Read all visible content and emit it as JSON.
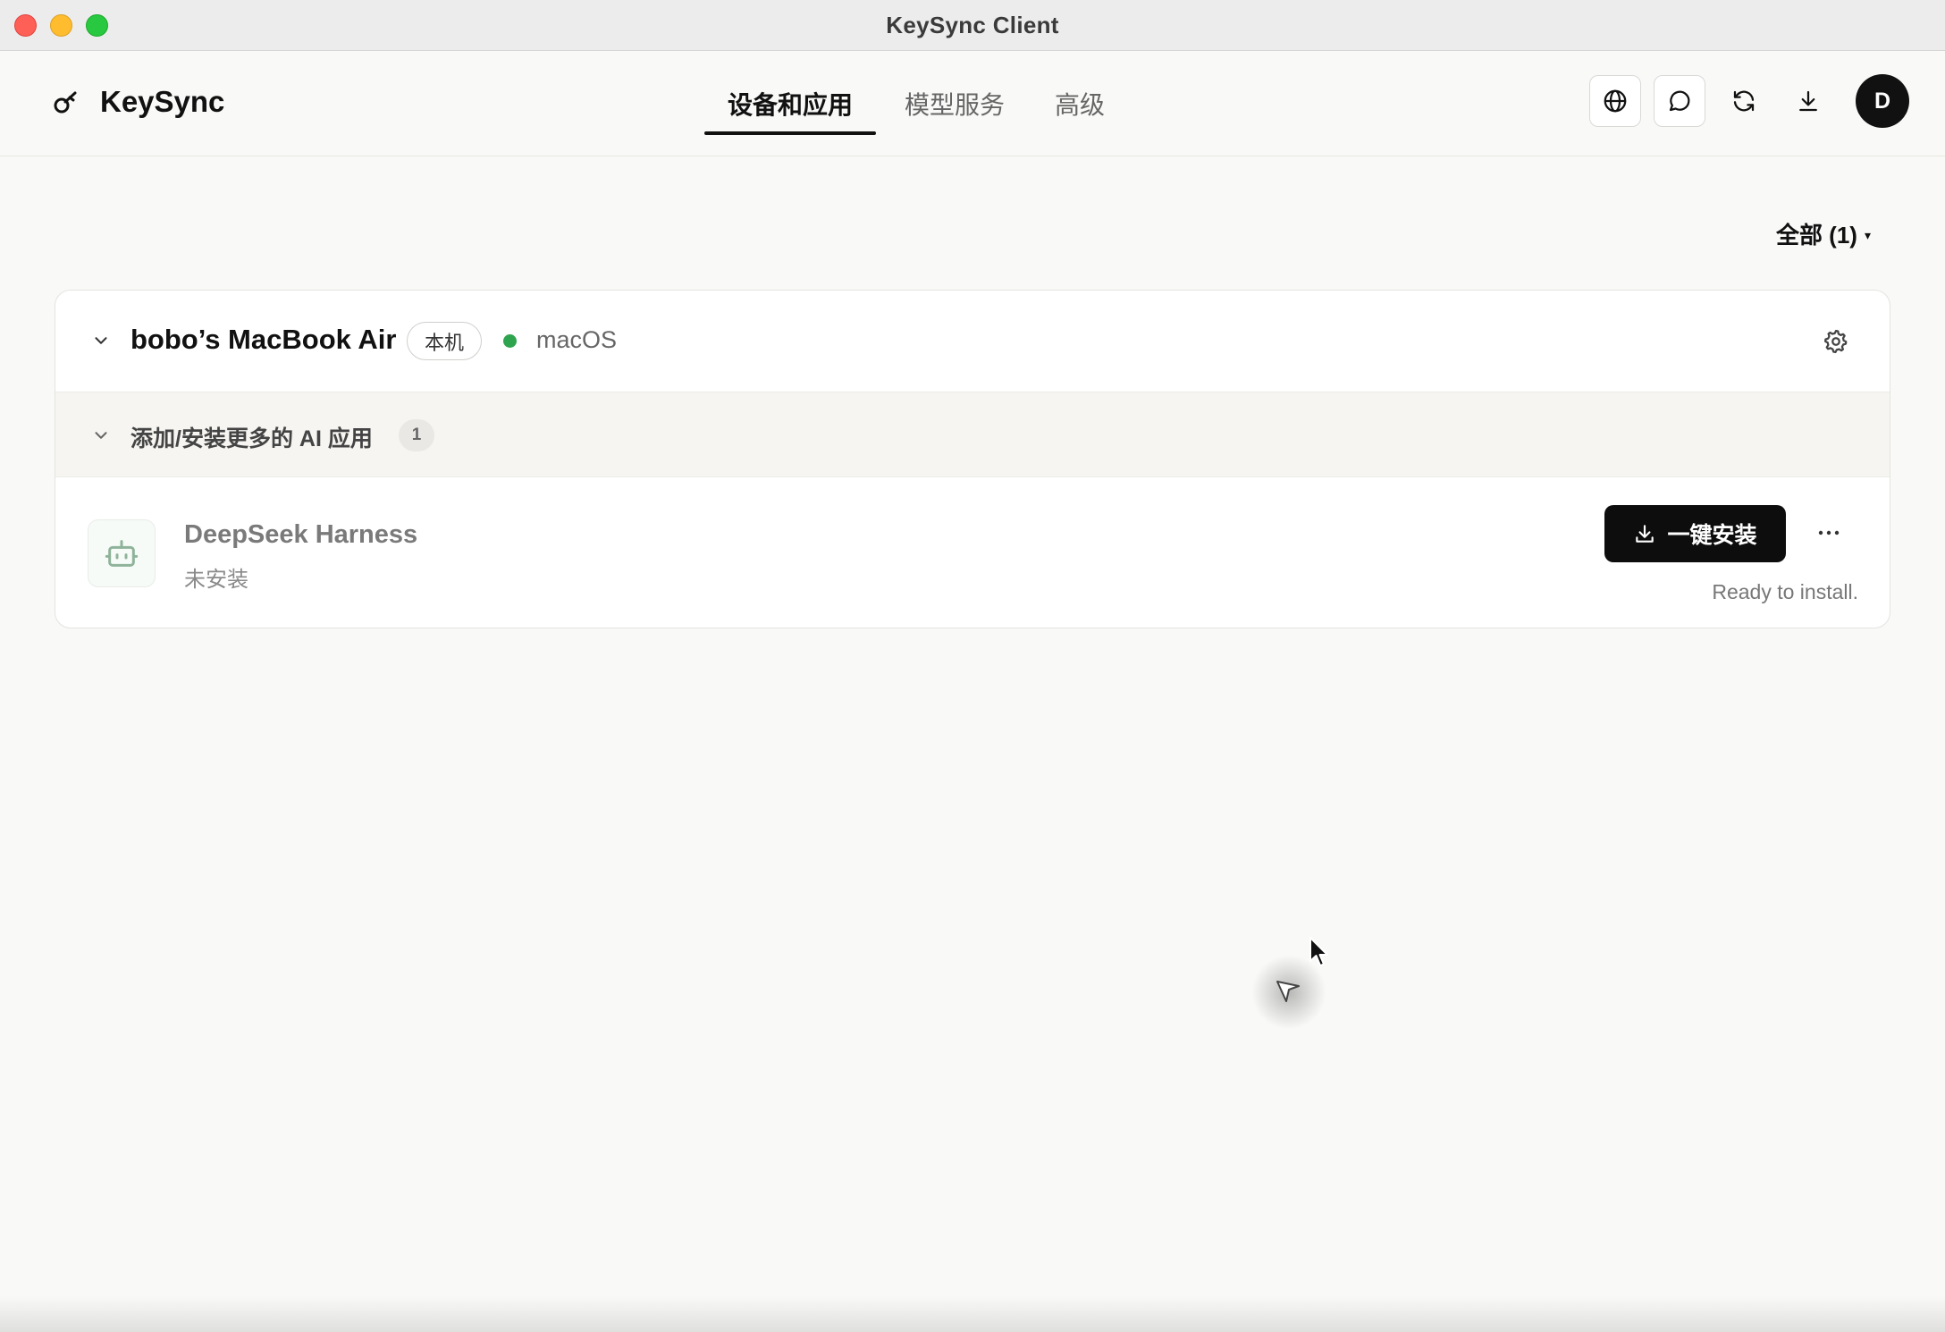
{
  "window": {
    "title": "KeySync Client"
  },
  "header": {
    "brand": "KeySync",
    "tabs": [
      {
        "label": "设备和应用",
        "active": true
      },
      {
        "label": "模型服务",
        "active": false
      },
      {
        "label": "高级",
        "active": false
      }
    ],
    "actions": [
      "globe-icon",
      "chat-icon",
      "refresh-icon",
      "download-icon"
    ],
    "avatar_initial": "D"
  },
  "filter": {
    "label": "全部 (1)",
    "caret": "▾"
  },
  "device": {
    "name": "bobo’s MacBook Air",
    "badge": "本机",
    "status_color": "#2ea44f",
    "os": "macOS"
  },
  "section": {
    "title": "添加/安装更多的 AI 应用",
    "count": "1"
  },
  "app": {
    "name": "DeepSeek Harness",
    "status": "未安装",
    "install_label": "一键安装",
    "ready_text": "Ready to install."
  }
}
